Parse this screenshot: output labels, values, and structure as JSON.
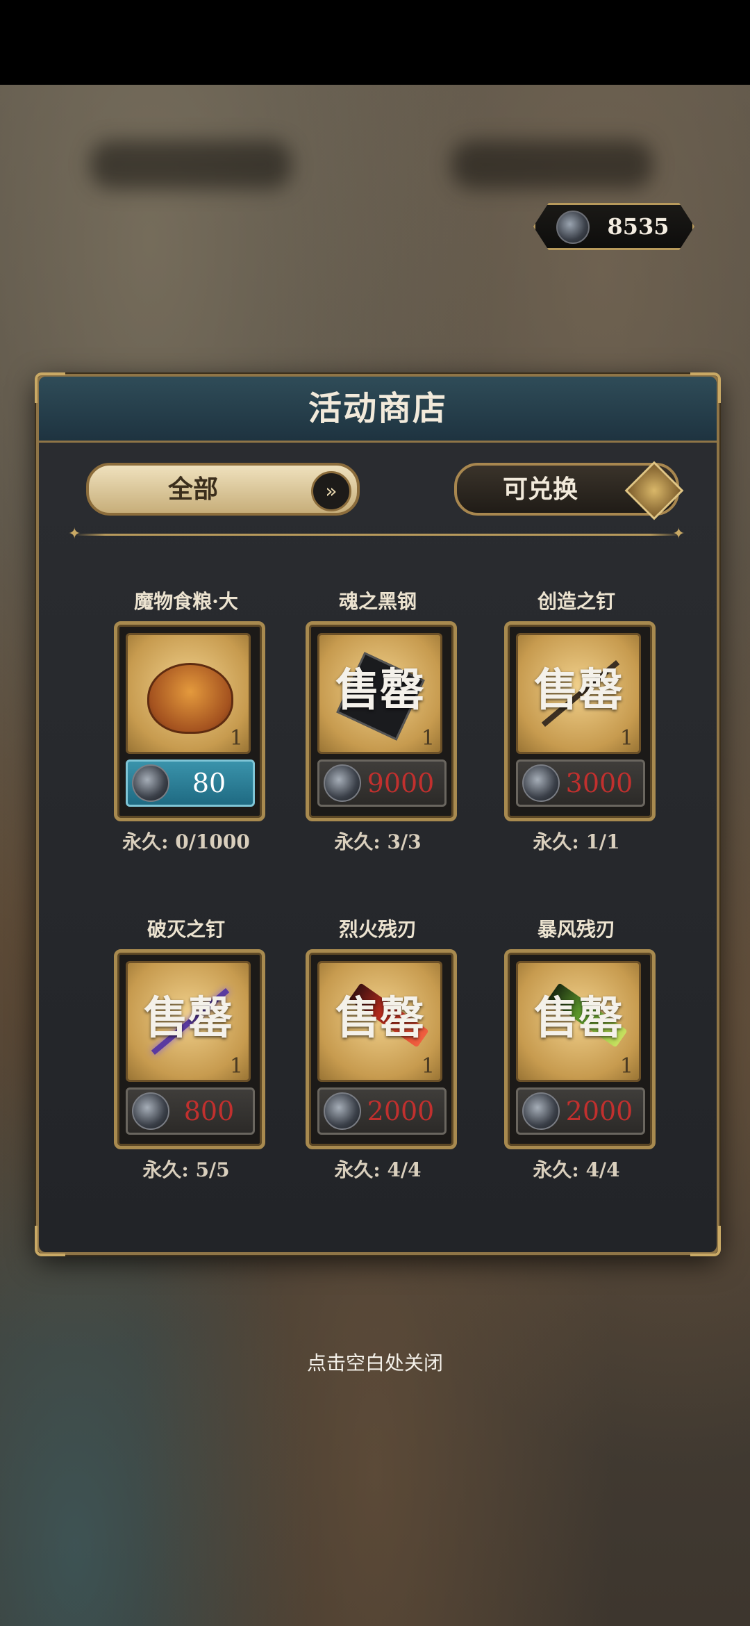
{
  "currency": {
    "amount": "8535",
    "icon": "soul-coin-icon"
  },
  "panel": {
    "title": "活动商店"
  },
  "filters": {
    "all_label": "全部",
    "exchangeable_label": "可兑换"
  },
  "items": [
    {
      "name": "魔物食粮·大",
      "qty": "1",
      "price": "80",
      "limit": "永久: 0/1000",
      "sold_out": "",
      "price_active": true
    },
    {
      "name": "魂之黑钢",
      "qty": "1",
      "price": "9000",
      "limit": "永久: 3/3",
      "sold_out": "售罄",
      "price_active": false
    },
    {
      "name": "创造之钉",
      "qty": "1",
      "price": "3000",
      "limit": "永久: 1/1",
      "sold_out": "售罄",
      "price_active": false
    },
    {
      "name": "破灭之钉",
      "qty": "1",
      "price": "800",
      "limit": "永久: 5/5",
      "sold_out": "售罄",
      "price_active": false
    },
    {
      "name": "烈火残刃",
      "qty": "1",
      "price": "2000",
      "limit": "永久: 4/4",
      "sold_out": "售罄",
      "price_active": false
    },
    {
      "name": "暴风残刃",
      "qty": "1",
      "price": "2000",
      "limit": "永久: 4/4",
      "sold_out": "售罄",
      "price_active": false
    }
  ],
  "close_hint": "点击空白处关闭",
  "colors": {
    "price_red": "#c1302e",
    "active_price_bg": "#2a8199",
    "gold_border": "#a88a4f"
  }
}
